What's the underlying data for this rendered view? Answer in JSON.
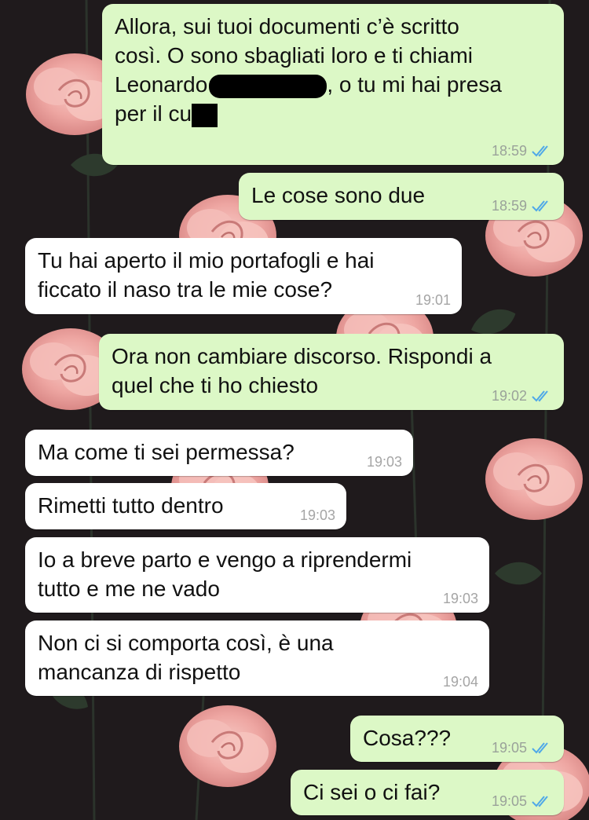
{
  "messages": [
    {
      "direction": "outgoing",
      "text_before": "Allora, sui tuoi documenti c’è scritto\ncosì. O sono sbagliati loro e ti chiami\nLeonardo",
      "text_middle": ", o tu mi hai presa\nper il cu",
      "time": "18:59",
      "status": "read"
    },
    {
      "direction": "outgoing",
      "text": "Le cose sono due",
      "time": "18:59",
      "status": "read"
    },
    {
      "direction": "incoming",
      "text": "Tu hai aperto il mio portafogli e hai\nficcato il naso tra le mie cose?",
      "time": "19:01"
    },
    {
      "direction": "outgoing",
      "text": "Ora non cambiare discorso. Rispondi a\nquel che ti ho chiesto",
      "time": "19:02",
      "status": "read"
    },
    {
      "direction": "incoming",
      "text": "Ma come ti sei permessa?",
      "time": "19:03"
    },
    {
      "direction": "incoming",
      "text": "Rimetti tutto dentro",
      "time": "19:03"
    },
    {
      "direction": "incoming",
      "text": "Io a breve parto e vengo a riprendermi\ntutto e me ne vado",
      "time": "19:03"
    },
    {
      "direction": "incoming",
      "text": "Non ci si comporta così, è una\nmancanza di rispetto",
      "time": "19:04"
    },
    {
      "direction": "outgoing",
      "text": "Cosa???",
      "time": "19:05",
      "status": "read"
    },
    {
      "direction": "outgoing",
      "text": "Ci sei o ci fai?",
      "time": "19:05",
      "status": "read"
    }
  ],
  "colors": {
    "outgoing_bubble": "#dcf8c6",
    "incoming_bubble": "#ffffff",
    "read_ticks": "#4fa8e8",
    "background": "#1f1a1c",
    "rose": "#f2b3b0"
  },
  "icons": {
    "read_receipt": "double-check-icon",
    "background_decor": "rose-pattern"
  }
}
